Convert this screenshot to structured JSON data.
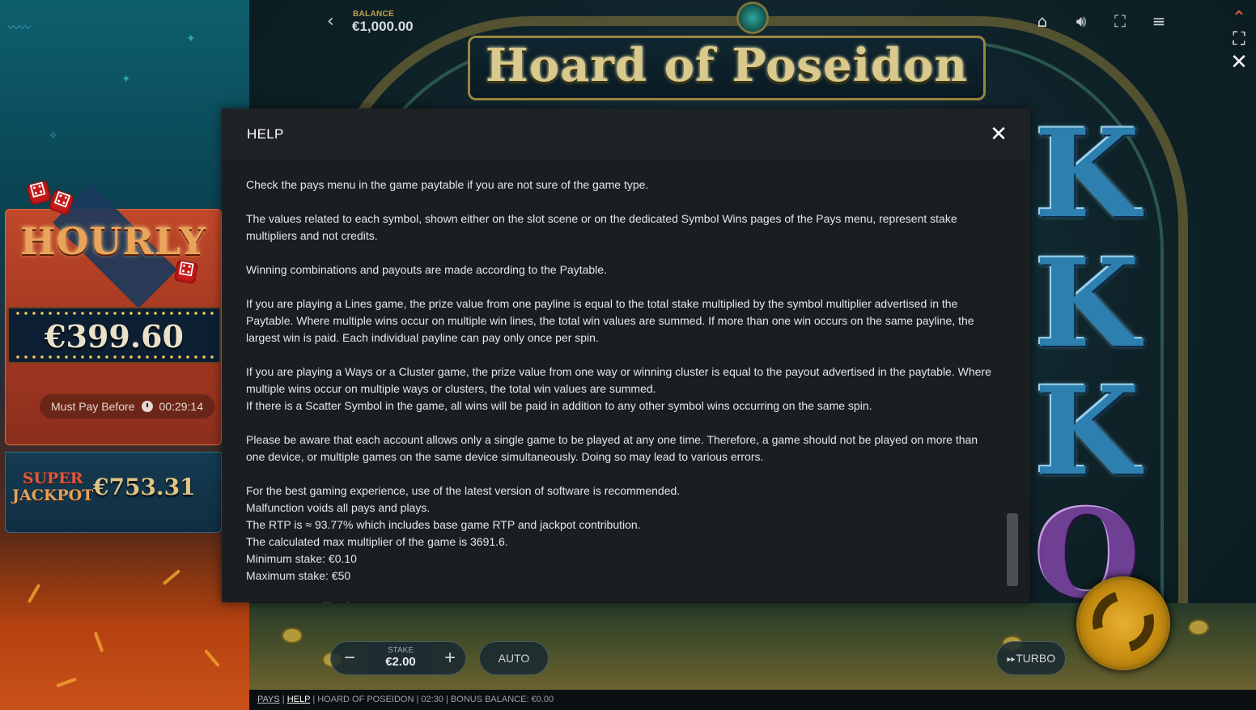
{
  "left_panel": {
    "hourly": {
      "title": "HOURLY",
      "amount": "€399.60",
      "must_pay_label": "Must Pay Before",
      "countdown": "00:29:14"
    },
    "super_jackpot": {
      "label_line1": "SUPER",
      "label_line2": "JACKPOT",
      "amount": "€753.31"
    }
  },
  "hud": {
    "back_icon": "chevron-left-icon",
    "balance_label": "BALANCE",
    "balance_value": "€1,000.00",
    "icons": [
      "home-icon",
      "sound-icon",
      "fullscreen-icon",
      "menu-icon"
    ]
  },
  "side_controls": [
    "chevron-up-icon",
    "expand-icon",
    "close-icon"
  ],
  "game": {
    "title": "Hoard of Poseidon",
    "reel_symbols": [
      "K",
      "K",
      "K",
      "Q"
    ]
  },
  "help_modal": {
    "title": "HELP",
    "paragraphs": [
      [
        "Check the pays menu in the game paytable if you are not sure of the game type."
      ],
      [
        "The values related to each symbol, shown either on the slot scene or on the dedicated Symbol Wins pages of the Pays menu, represent stake multipliers and not credits."
      ],
      [
        "Winning combinations and payouts are made according to the Paytable."
      ],
      [
        "If you are playing a Lines game, the prize value from one payline is equal to the total stake multiplied by the symbol multiplier advertised in the Paytable. Where multiple wins occur on multiple win lines, the total win values are summed. If more than one win occurs on the same payline, the largest win is paid. Each individual payline can pay only once per spin."
      ],
      [
        "If you are playing a Ways or a Cluster game, the prize value from one way or winning cluster is equal to the payout advertised in the paytable. Where multiple wins occur on multiple ways or clusters, the total win values are summed.",
        "If there is a Scatter Symbol in the game, all wins will be paid in addition to any other symbol wins occurring on the same spin."
      ],
      [
        "Please be aware that each account allows only a single game to be played at any one time. Therefore, a game should not be played on more than one device, or multiple games on the same device simultaneously. Doing so may lead to various errors."
      ],
      [
        "For the best gaming experience, use of the latest version of software is recommended.",
        "Malfunction voids all pays and plays.",
        "The RTP is ≈ 93.77% which includes base game RTP and jackpot contribution.",
        "The calculated max multiplier of the game is 3691.6.",
        "Minimum stake: €0.10",
        "Maximum stake: €50"
      ]
    ]
  },
  "controls": {
    "stake_minus": "−",
    "stake_label": "STAKE",
    "stake_value": "€2.00",
    "stake_plus": "+",
    "auto_label": "AUTO",
    "turbo_label": "TURBO",
    "spin_icon": "spin-arrows-icon"
  },
  "footer": {
    "pays": "PAYS",
    "help": "HELP",
    "game_name": "HOARD OF POSEIDON",
    "time": "02:30",
    "bonus_balance": "BONUS BALANCE: €0.00"
  }
}
